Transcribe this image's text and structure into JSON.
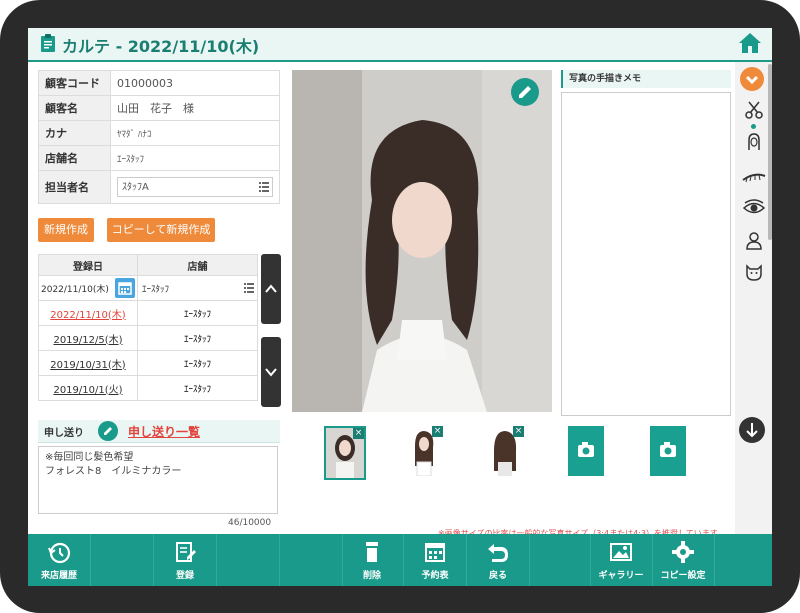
{
  "header": {
    "title": "カルテ - 2022/11/10(木)"
  },
  "customer": {
    "rows": [
      {
        "label": "顧客コード",
        "value": "01000003"
      },
      {
        "label": "顧客名",
        "value": "山田　花子　様"
      },
      {
        "label": "カナ",
        "value": "ﾔﾏﾀﾞ ﾊﾅｺ"
      },
      {
        "label": "店舗名",
        "value": "ｴｰｽﾀｯﾌ"
      }
    ],
    "staff_label": "担当者名",
    "staff_value": "ｽﾀｯﾌA"
  },
  "buttons": {
    "new": "新規作成",
    "copy_new": "コピーして新規作成"
  },
  "history": {
    "headers": [
      "登録日",
      "店舗"
    ],
    "filter_date": "2022/11/10(木)",
    "filter_shop": "ｴｰｽﾀｯﾌ",
    "rows": [
      {
        "date": "2022/11/10(木)",
        "shop": "ｴｰｽﾀｯﾌ"
      },
      {
        "date": "2019/12/5(木)",
        "shop": "ｴｰｽﾀｯﾌ"
      },
      {
        "date": "2019/10/31(木)",
        "shop": "ｴｰｽﾀｯﾌ"
      },
      {
        "date": "2019/10/1(火)",
        "shop": "ｴｰｽﾀｯﾌ"
      }
    ]
  },
  "send": {
    "label": "申し送り",
    "link": "申し送り一覧",
    "line1": "※毎回同じ髪色希望",
    "line2": "フォレスト8　イルミナカラー",
    "counter": "46/10000"
  },
  "memo": {
    "title": "写真の手描きメモ"
  },
  "note": "※画像サイズの比率は一般的な写真サイズ（3:4または4:3）を推奨しています",
  "footer": {
    "visit_history": "来店履歴",
    "register": "登録",
    "delete": "削除",
    "booking": "予約表",
    "back": "戻る",
    "gallery": "ギャラリー",
    "copy_settings": "コピー設定"
  },
  "colors": {
    "accent": "#1a9a8a",
    "orange": "#ee8a3a",
    "link_red": "#e0443c"
  }
}
